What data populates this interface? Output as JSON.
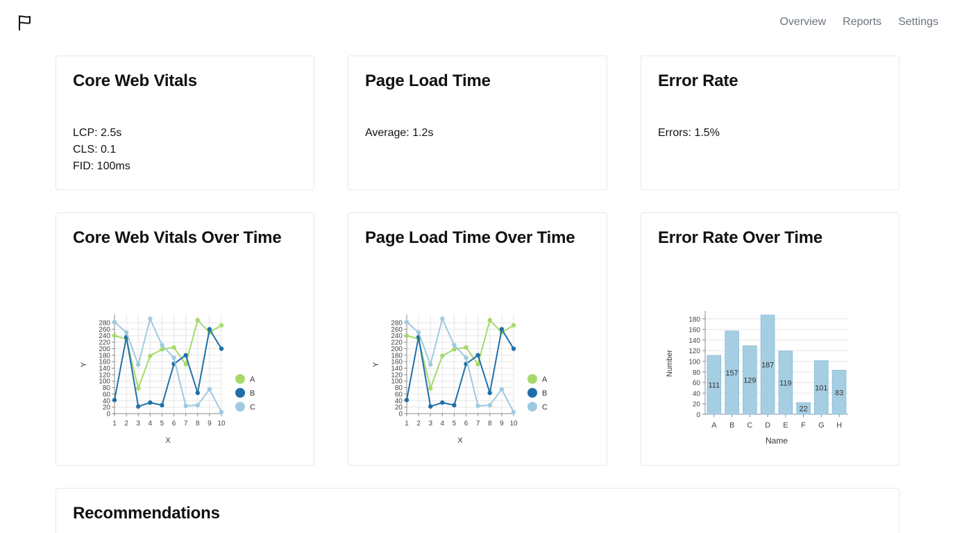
{
  "header": {
    "logo_icon": "flag-icon",
    "nav": [
      "Overview",
      "Reports",
      "Settings"
    ]
  },
  "cards": {
    "vitals": {
      "title": "Core Web Vitals",
      "lines": [
        "LCP: 2.5s",
        "CLS: 0.1",
        "FID: 100ms"
      ]
    },
    "load": {
      "title": "Page Load Time",
      "lines": [
        "Average: 1.2s"
      ]
    },
    "error": {
      "title": "Error Rate",
      "lines": [
        "Errors: 1.5%"
      ]
    },
    "vitals_chart": {
      "title": "Core Web Vitals Over Time"
    },
    "load_chart": {
      "title": "Page Load Time Over Time"
    },
    "error_chart": {
      "title": "Error Rate Over Time"
    },
    "recommendations": {
      "title": "Recommendations"
    }
  },
  "colors": {
    "A": "#a6d96a",
    "B": "#1f6fa8",
    "C": "#9ecae1",
    "bar": "#a6cee3"
  },
  "chart_data": [
    {
      "type": "line",
      "xlabel": "X",
      "ylabel": "Y",
      "x": [
        1,
        2,
        3,
        4,
        5,
        6,
        7,
        8,
        9,
        10
      ],
      "ylim": [
        0,
        280
      ],
      "yticks": [
        0,
        20,
        40,
        60,
        80,
        100,
        120,
        140,
        160,
        180,
        200,
        220,
        240,
        260,
        280
      ],
      "grid": true,
      "legend_position": "right",
      "series": [
        {
          "name": "A",
          "values": [
            240,
            230,
            78,
            178,
            198,
            204,
            152,
            288,
            250,
            272
          ]
        },
        {
          "name": "B",
          "values": [
            42,
            236,
            22,
            34,
            26,
            153,
            180,
            64,
            260,
            200
          ]
        },
        {
          "name": "C",
          "values": [
            282,
            250,
            151,
            292,
            211,
            172,
            24,
            26,
            75,
            5
          ]
        }
      ]
    },
    {
      "type": "line",
      "xlabel": "X",
      "ylabel": "Y",
      "x": [
        1,
        2,
        3,
        4,
        5,
        6,
        7,
        8,
        9,
        10
      ],
      "ylim": [
        0,
        280
      ],
      "yticks": [
        0,
        20,
        40,
        60,
        80,
        100,
        120,
        140,
        160,
        180,
        200,
        220,
        240,
        260,
        280
      ],
      "grid": true,
      "legend_position": "right",
      "series": [
        {
          "name": "A",
          "values": [
            240,
            230,
            78,
            178,
            198,
            204,
            152,
            288,
            250,
            272
          ]
        },
        {
          "name": "B",
          "values": [
            42,
            236,
            22,
            34,
            26,
            153,
            180,
            64,
            260,
            200
          ]
        },
        {
          "name": "C",
          "values": [
            282,
            250,
            151,
            292,
            211,
            172,
            24,
            26,
            75,
            5
          ]
        }
      ]
    },
    {
      "type": "bar",
      "xlabel": "Name",
      "ylabel": "Number",
      "categories": [
        "A",
        "B",
        "C",
        "D",
        "E",
        "F",
        "G",
        "H"
      ],
      "values": [
        111,
        157,
        129,
        187,
        119,
        22,
        101,
        83
      ],
      "ylim": [
        0,
        187
      ],
      "yticks": [
        0,
        20,
        40,
        60,
        80,
        100,
        120,
        140,
        160,
        180
      ],
      "grid": true
    }
  ]
}
